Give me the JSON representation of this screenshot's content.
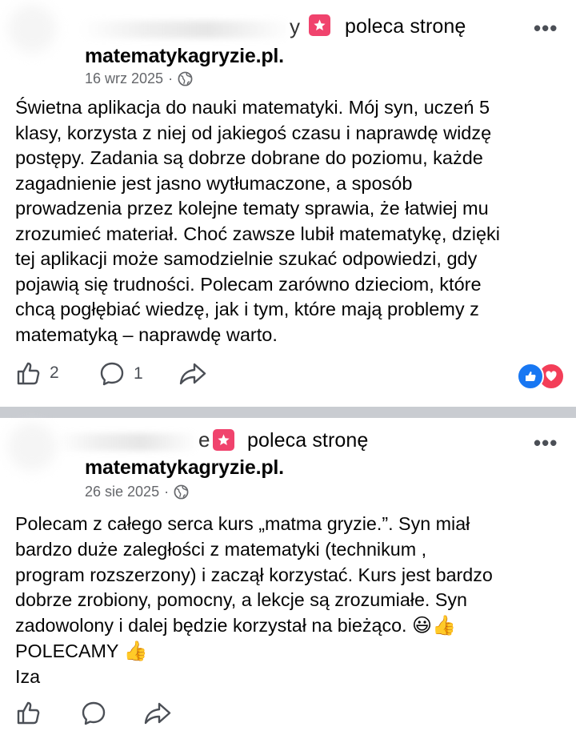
{
  "posts": [
    {
      "author_partial": "y",
      "recommend_text": "poleca stronę",
      "page_name": "matematykagryzie.pl.",
      "date": "16 wrz 2025",
      "body": "Świetna aplikacja do nauki matematyki. Mój syn, uczeń 5\nklasy, korzysta z niej od jakiegoś czasu i naprawdę widzę\npostępy. Zadania są dobrze dobrane do poziomu, każde\nzagadnienie jest jasno wytłumaczone, a sposób\nprowadzenia przez kolejne tematy sprawia, że łatwiej mu\nzrozumieć materiał. Choć zawsze lubił matematykę, dzięki\ntej aplikacji może samodzielnie szukać odpowiedzi, gdy\npojawią się trudności. Polecam zarówno dzieciom, które\nchcą pogłębiać wiedzę, jak i tym, które mają problemy z\nmatematyką – naprawdę warto.",
      "like_count": "2",
      "comment_count": "1",
      "reactions": [
        "like",
        "love"
      ]
    },
    {
      "author_partial": "e",
      "recommend_text": "poleca stronę",
      "page_name": "matematykagryzie.pl.",
      "date": "26 sie 2025",
      "body_lines": [
        "Polecam z całego serca kurs „matma gryzie.”. Syn miał",
        "bardzo duże zaległości z matematyki (technikum ,",
        "program rozszerzony)  i zaczął korzystać. Kurs jest bardzo",
        "dobrze zrobiony, pomocny, a lekcje są zrozumiałe. Syn",
        "zadowolony i dalej będzie korzystał na bieżąco.",
        "POLECAMY",
        "Iza"
      ],
      "emoji_line5": [
        "😃",
        "👍"
      ],
      "emoji_line6": [
        "👍"
      ]
    }
  ],
  "icons": {
    "recommend": "star-badge-icon",
    "privacy": "globe-icon",
    "more": "more-options-icon",
    "like": "thumbs-up-icon",
    "comment": "comment-bubble-icon",
    "share": "share-arrow-icon"
  },
  "colors": {
    "recommend_badge": "#f0436d",
    "like_reaction": "#1877f2",
    "love_reaction": "#f33e58",
    "divider": "#c9ccd1",
    "meta_text": "#65676b"
  }
}
